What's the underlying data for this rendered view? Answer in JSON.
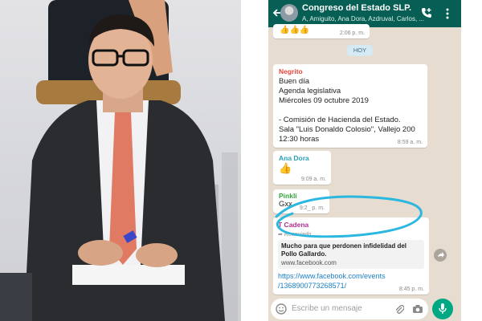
{
  "chat": {
    "header": {
      "title": "Congreso del Estado SLP.",
      "subtitle": "A, Amiguito, Ana Dora, Azdruval, Carlos, ..."
    },
    "day_badge": "HOY",
    "messages": [
      {
        "sender": "",
        "body": "👍👍👍",
        "time": "2:06 p. m."
      },
      {
        "sender": "Negrito",
        "sender_color": "#e8453c",
        "body": "Buen día\nAgenda legislativa\nMiércoles 09 octubre 2019\n\n- Comisión de Hacienda del Estado.\nSala \"Luis Donaldo Colosio\", Vallejo 200\n12:30 horas",
        "time": "8:59 a. m."
      },
      {
        "sender": "Ana Dora",
        "sender_color": "#2aa0b5",
        "body": "👍",
        "time": "9:09 a. m."
      },
      {
        "sender": "Pinkli",
        "sender_color": "#35a43a",
        "body": "Gxx",
        "time": "9:2_ p. m."
      },
      {
        "sender": "T Cadena",
        "sender_color": "#b0308f",
        "forwarded": "Reenviado",
        "preview_title": "Mucho para que perdonen infidelidad del Pollo Gallardo.",
        "preview_domain": "www.facebook.com",
        "link": "https://www.facebook.com/events\n/1368900773268571/",
        "time": "8:45 p. m."
      }
    ],
    "input": {
      "placeholder": "Escribe un mensaje"
    }
  },
  "colors": {
    "header": "#075e54",
    "wallpaper": "#e6dcd0",
    "link": "#1b7fc9",
    "mic": "#00a884",
    "annotation": "#2ab7e0"
  },
  "icons": [
    "back-arrow-icon",
    "add-call-icon",
    "more-menu-icon",
    "emoji-icon",
    "attach-icon",
    "camera-icon",
    "mic-icon",
    "share-icon"
  ]
}
